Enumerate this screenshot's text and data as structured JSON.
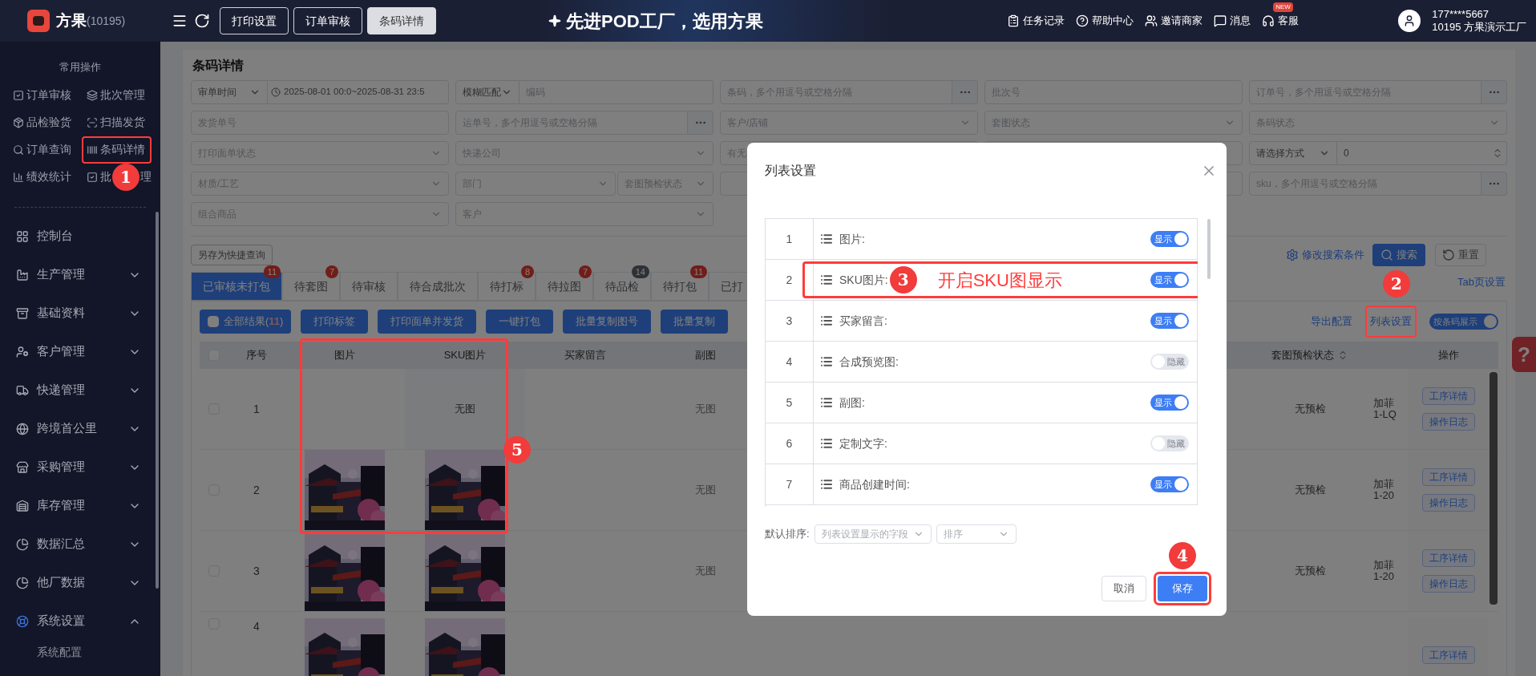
{
  "topbar": {
    "brand": "方果",
    "brand_id": "(10195)",
    "nav_buttons": [
      {
        "label": "打印设置",
        "selected": false
      },
      {
        "label": "订单审核",
        "selected": false
      },
      {
        "label": "条码详情",
        "selected": true
      }
    ],
    "banner": "先进POD工厂，选用方果",
    "links": [
      {
        "kind": "tasks",
        "label": "任务记录"
      },
      {
        "kind": "help",
        "label": "帮助中心"
      },
      {
        "kind": "invite",
        "label": "邀请商家"
      },
      {
        "kind": "message",
        "label": "消息"
      },
      {
        "kind": "service",
        "label": "客服",
        "badge": "NEW"
      }
    ],
    "user": {
      "phone": "177****5667",
      "org": "10195 方果演示工厂"
    }
  },
  "sidebar": {
    "quick_title": "常用操作",
    "quick_items": [
      {
        "kind": "check",
        "label": "订单审核",
        "highlighted": false
      },
      {
        "kind": "batch",
        "label": "批次管理",
        "highlighted": false
      },
      {
        "kind": "box",
        "label": "品检验货",
        "highlighted": false
      },
      {
        "kind": "scan",
        "label": "扫描发货",
        "highlighted": false
      },
      {
        "kind": "search",
        "label": "订单查询",
        "highlighted": false
      },
      {
        "kind": "barcode",
        "label": "条码详情",
        "highlighted": true
      },
      {
        "kind": "chart",
        "label": "绩效统计",
        "highlighted": false
      },
      {
        "kind": "check",
        "label": "批",
        "label_tail": "理",
        "highlighted": false
      }
    ],
    "nav": [
      {
        "kind": "dashboard",
        "label": "控制台"
      },
      {
        "kind": "production",
        "label": "生产管理",
        "expanded": false
      },
      {
        "kind": "base",
        "label": "基础资料",
        "expanded": false
      },
      {
        "kind": "customer",
        "label": "客户管理",
        "expanded": false
      },
      {
        "kind": "express",
        "label": "快递管理",
        "expanded": false
      },
      {
        "kind": "globe",
        "label": "跨境首公里",
        "expanded": false
      },
      {
        "kind": "purchase",
        "label": "采购管理",
        "expanded": false
      },
      {
        "kind": "stock",
        "label": "库存管理",
        "expanded": false
      },
      {
        "kind": "pie",
        "label": "数据汇总",
        "expanded": false
      },
      {
        "kind": "pie",
        "label": "他厂数据",
        "expanded": false
      },
      {
        "kind": "settings",
        "label": "系统设置",
        "expanded": true,
        "children": [
          {
            "label": "系统配置"
          }
        ]
      }
    ]
  },
  "page_title": "条码详情",
  "filters": [
    [
      {
        "kind": "date_range",
        "select": "审单时间",
        "value": "2025-08-01 00:0~2025-08-31 23:5"
      },
      {
        "kind": "match",
        "select": "模糊匹配",
        "placeholder": "编码"
      },
      {
        "kind": "multi",
        "placeholder": "条码，多个用逗号或空格分隔"
      },
      {
        "kind": "input",
        "placeholder": "批次号"
      },
      {
        "kind": "multi",
        "placeholder": "订单号，多个用逗号或空格分隔"
      }
    ],
    [
      {
        "kind": "input",
        "placeholder": "发货单号"
      },
      {
        "kind": "multi",
        "placeholder": "运单号，多个用逗号或空格分隔"
      },
      {
        "kind": "select",
        "placeholder": "客户/店铺"
      },
      {
        "kind": "select",
        "placeholder": "套图状态"
      },
      {
        "kind": "select",
        "placeholder": "条码状态"
      }
    ],
    [
      {
        "kind": "select",
        "placeholder": "打印面单状态"
      },
      {
        "kind": "select",
        "placeholder": "快递公司"
      },
      {
        "kind": "input",
        "placeholder": "有无"
      },
      {
        "kind": "blank"
      },
      {
        "kind": "number",
        "select": "请选择方式",
        "value": "0"
      }
    ],
    [
      {
        "kind": "select",
        "placeholder": "材质/工艺"
      },
      {
        "kind": "pair",
        "selects": [
          "部门",
          "套图预检状态"
        ]
      },
      {
        "kind": "blank"
      },
      {
        "kind": "blank"
      },
      {
        "kind": "multi",
        "placeholder": "sku，多个用逗号或空格分隔"
      }
    ],
    [
      {
        "kind": "select",
        "placeholder": "组合商品"
      },
      {
        "kind": "select",
        "placeholder": "客户"
      }
    ]
  ],
  "save_query": "另存为快捷查询",
  "edit_conditions": "修改搜索条件",
  "search": "搜索",
  "reset": "重置",
  "tab_settings": "Tab页设置",
  "tabs": [
    {
      "label": "已审核未打包",
      "badge": "11",
      "selected": true
    },
    {
      "label": "待套图",
      "badge": "7",
      "selected": false
    },
    {
      "label": "待审核",
      "selected": false
    },
    {
      "label": "待合成批次",
      "selected": false
    },
    {
      "label": "待打标",
      "badge": "8",
      "selected": false
    },
    {
      "label": "待拉图",
      "badge": "7",
      "selected": false
    },
    {
      "label": "待品检",
      "badge": "14",
      "badge_muted": true,
      "selected": false
    },
    {
      "label": "待打包",
      "badge": "11",
      "selected": false
    },
    {
      "label": "已打",
      "selected": false
    }
  ],
  "select_all": {
    "label": "全部结果(",
    "count": "11",
    "close": ")",
    "checked": false
  },
  "header_checked": false,
  "actions": [
    "打印标签",
    "打印面单并发货",
    "一键打包",
    "批量复制图号",
    "批量复制"
  ],
  "export_config": "导出配置",
  "list_settings": {
    "label": "列表设置",
    "highlighted": true
  },
  "by_barcode": {
    "label": "按条码展示",
    "on": true
  },
  "columns": {
    "index": "序号",
    "image": "图片",
    "sku_image": "SKU图片",
    "message": "买家留言",
    "sub": "副图",
    "precheck": "套图预检状态",
    "ops": "操作"
  },
  "rows": [
    {
      "index": "1",
      "checked": false,
      "has_image": false,
      "sku_text": "无图",
      "sub": "无图",
      "precheck": "无预检",
      "product": [
        "加菲",
        "1-LQ"
      ],
      "ops": [
        "工序详情",
        "操作日志"
      ]
    },
    {
      "index": "2",
      "checked": false,
      "has_image": true,
      "sub": "无图",
      "precheck": "无预检",
      "product": [
        "加菲",
        "1-20"
      ],
      "ops": [
        "工序详情",
        "操作日志"
      ]
    },
    {
      "index": "3",
      "checked": false,
      "has_image": true,
      "sub": "无图",
      "precheck": "无预检",
      "product": [
        "加菲",
        "1-20"
      ],
      "ops": [
        "工序详情",
        "操作日志"
      ]
    },
    {
      "index": "4",
      "checked": false,
      "has_image": true,
      "ops": [
        "工序详情"
      ]
    }
  ],
  "help_tab": "?",
  "modal": {
    "title": "列表设置",
    "rows": [
      {
        "index": "1",
        "label": "图片:",
        "on": true,
        "toggle_text": "显示",
        "highlighted": false
      },
      {
        "index": "2",
        "label": "SKU图片:",
        "on": true,
        "toggle_text": "显示",
        "highlighted": true
      },
      {
        "index": "3",
        "label": "买家留言:",
        "on": true,
        "toggle_text": "显示",
        "highlighted": false
      },
      {
        "index": "4",
        "label": "合成预览图:",
        "on": false,
        "toggle_text": "隐藏",
        "highlighted": false
      },
      {
        "index": "5",
        "label": "副图:",
        "on": true,
        "toggle_text": "显示",
        "highlighted": false
      },
      {
        "index": "6",
        "label": "定制文字:",
        "on": false,
        "toggle_text": "隐藏",
        "highlighted": false
      },
      {
        "index": "7",
        "label": "商品创建时间:",
        "on": true,
        "toggle_text": "显示",
        "highlighted": false
      }
    ],
    "sort_label": "默认排序:",
    "sort_field": "列表设置显示的字段",
    "sort_order": "排序",
    "cancel": "取消",
    "save": {
      "label": "保存",
      "highlighted": true
    }
  },
  "callouts": [
    {
      "number": "1"
    },
    {
      "number": "2"
    },
    {
      "number": "3",
      "note": "开启SKU图显示"
    },
    {
      "number": "4"
    },
    {
      "number": "5"
    }
  ]
}
